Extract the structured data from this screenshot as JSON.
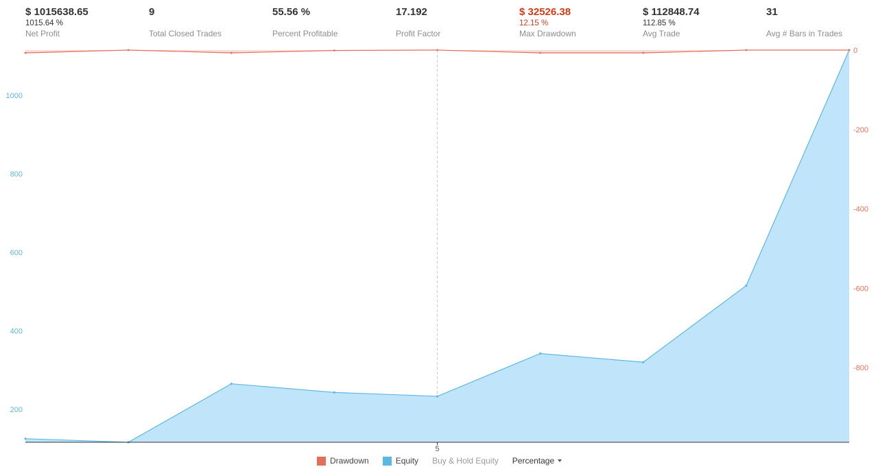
{
  "stats": [
    {
      "value": "$ 1015638.65",
      "sub": "1015.64 %",
      "label": "Net Profit",
      "negative": false
    },
    {
      "value": "9",
      "sub": "",
      "label": "Total Closed Trades",
      "negative": false
    },
    {
      "value": "55.56 %",
      "sub": "",
      "label": "Percent Profitable",
      "negative": false
    },
    {
      "value": "17.192",
      "sub": "",
      "label": "Profit Factor",
      "negative": false
    },
    {
      "value": "$ 32526.38",
      "sub": "12.15 %",
      "label": "Max Drawdown",
      "negative": true
    },
    {
      "value": "$ 112848.74",
      "sub": "112.85 %",
      "label": "Avg Trade",
      "negative": false
    },
    {
      "value": "31",
      "sub": "",
      "label": "Avg # Bars in Trades",
      "negative": false
    }
  ],
  "colors": {
    "equity_line": "#5bb8e0",
    "equity_fill": "#c0e5fb",
    "drawdown_line": "#e36f5a",
    "drawdown_fill": "#f9dcd5",
    "left_axis": "#5bb8e0",
    "right_axis": "#e36f5a",
    "baseline": "#333333",
    "crosshair": "#cccccc",
    "negative_text": "#d33a17"
  },
  "chart_data": {
    "type": "area",
    "x": [
      1,
      2,
      3,
      4,
      5,
      6,
      7,
      8,
      9
    ],
    "x_ticks": [
      5
    ],
    "series": [
      {
        "name": "Equity",
        "axis": "left",
        "values": [
          125,
          116,
          265,
          243,
          233,
          342,
          320,
          515,
          1115
        ]
      },
      {
        "name": "Drawdown",
        "axis": "right",
        "values": [
          -7,
          0,
          -7,
          -1,
          0,
          -7,
          -7,
          0,
          0
        ]
      }
    ],
    "left_axis": {
      "ticks": [
        200,
        400,
        600,
        800,
        1000
      ],
      "range": [
        116,
        1115
      ]
    },
    "right_axis": {
      "ticks": [
        0,
        -200,
        -400,
        -600,
        -800
      ],
      "range": [
        -988,
        0
      ]
    },
    "crosshair_x": 5,
    "legend": {
      "items": [
        {
          "label": "Drawdown",
          "color": "#e36f5a"
        },
        {
          "label": "Equity",
          "color": "#5bb8e0"
        }
      ],
      "buy_hold_label": "Buy & Hold Equity",
      "mode_label": "Percentage"
    }
  }
}
